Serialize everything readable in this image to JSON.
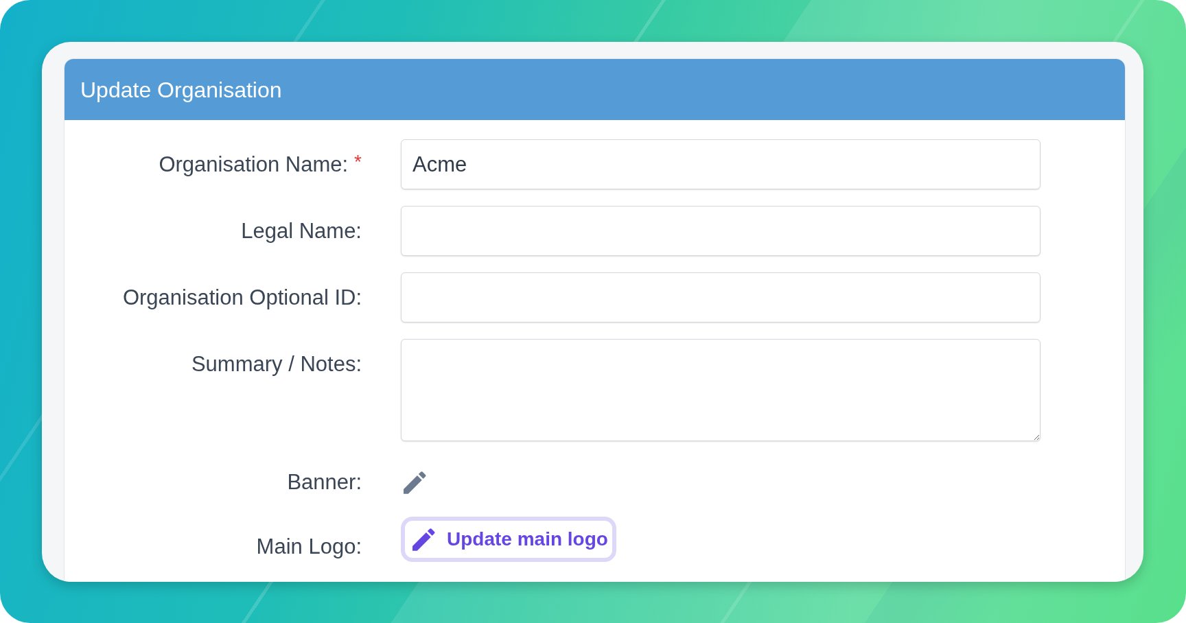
{
  "card": {
    "title": "Update Organisation"
  },
  "fields": [
    {
      "kind": "text",
      "label": "Organisation Name:",
      "required_mark": "*",
      "value": "Acme"
    },
    {
      "kind": "text",
      "label": "Legal Name:"
    },
    {
      "kind": "text",
      "label": "Organisation Optional ID:"
    },
    {
      "kind": "textarea",
      "label": "Summary / Notes:"
    },
    {
      "kind": "icon",
      "label": "Banner:"
    },
    {
      "kind": "button",
      "label": "Main Logo:",
      "button": "Update main logo"
    }
  ]
}
